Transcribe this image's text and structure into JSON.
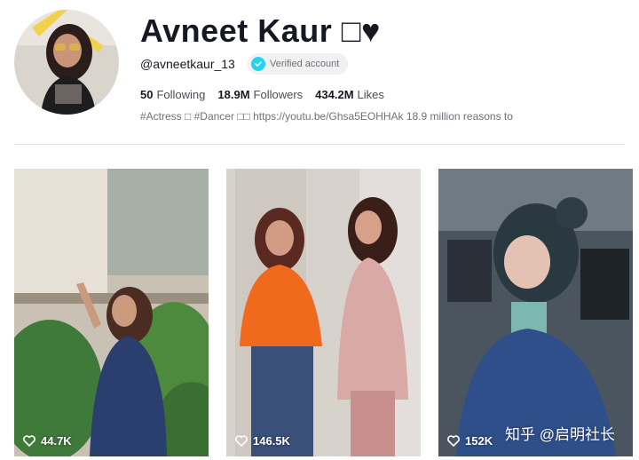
{
  "profile": {
    "display_name": "Avneet Kaur □♥",
    "username": "@avneetkaur_13",
    "verified_label": "Verified account",
    "stats": [
      {
        "value": "50",
        "label": "Following"
      },
      {
        "value": "18.9M",
        "label": "Followers"
      },
      {
        "value": "434.2M",
        "label": "Likes"
      }
    ],
    "bio": "#Actress □ #Dancer □□ https://youtu.be/Ghsa5EOHHAk 18.9 million reasons to"
  },
  "videos": [
    {
      "likes": "44.7K"
    },
    {
      "likes": "146.5K"
    },
    {
      "likes": "152K"
    }
  ],
  "watermark": "知乎 @启明社长",
  "colors": {
    "accent_verified": "#20d5ec",
    "text_primary": "#161823",
    "text_secondary": "#6f7079"
  }
}
